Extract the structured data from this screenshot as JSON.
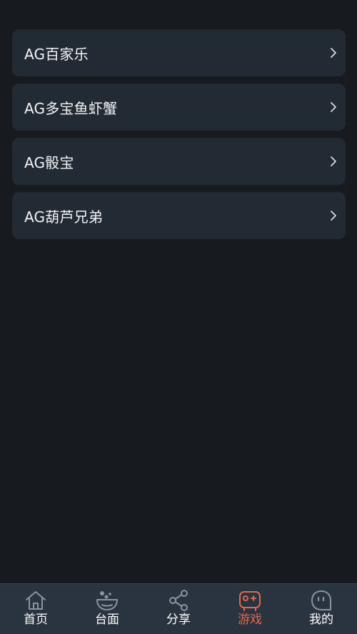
{
  "games": [
    {
      "label": "AG百家乐"
    },
    {
      "label": "AG多宝鱼虾蟹"
    },
    {
      "label": "AG骰宝"
    },
    {
      "label": "AG葫芦兄弟"
    }
  ],
  "tabs": [
    {
      "label": "首页",
      "icon": "home-icon",
      "active": false
    },
    {
      "label": "台面",
      "icon": "table-bowl-icon",
      "active": false
    },
    {
      "label": "分享",
      "icon": "share-icon",
      "active": false
    },
    {
      "label": "游戏",
      "icon": "gamepad-icon",
      "active": true
    },
    {
      "label": "我的",
      "icon": "profile-face-icon",
      "active": false
    }
  ],
  "colors": {
    "background": "#171b1f",
    "card": "#222a33",
    "tabbar": "#2a3440",
    "active": "#e06950",
    "inactive_icon": "#8a949e"
  }
}
